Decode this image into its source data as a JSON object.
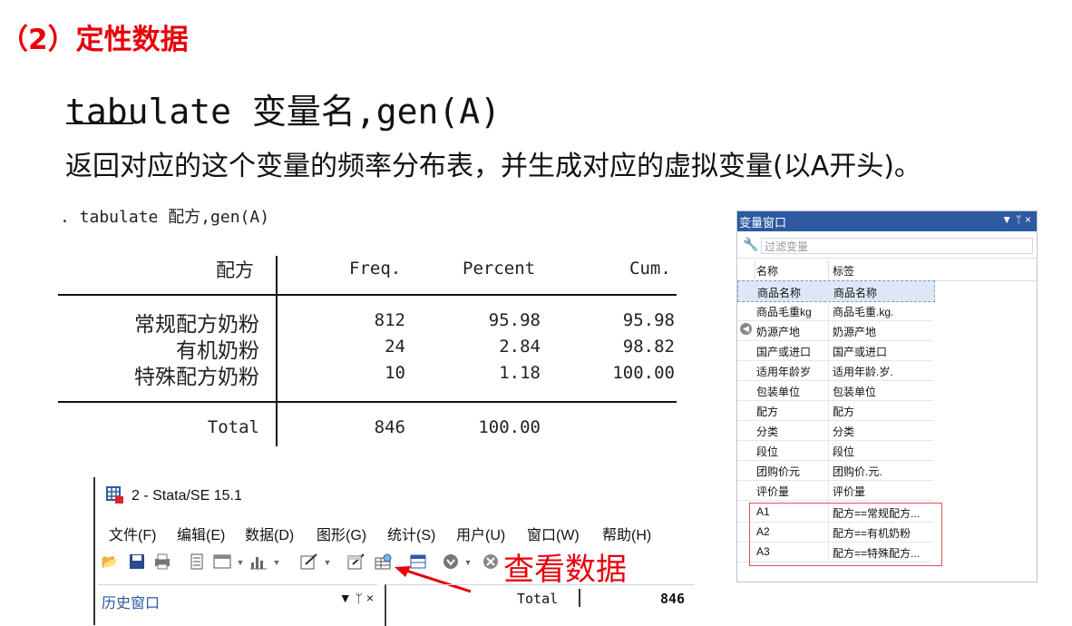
{
  "section_heading": "（2）定性数据",
  "command_syntax": "tabulate 变量名,gen(A)",
  "description": "返回对应的这个变量的频率分布表，并生成对应的虚拟变量(以A开头)。",
  "stata_output": {
    "command": ". tabulate 配方,gen(A)",
    "headers": {
      "var": "配方",
      "freq": "Freq.",
      "percent": "Percent",
      "cum": "Cum."
    },
    "rows": [
      {
        "label": "常规配方奶粉",
        "freq": "812",
        "percent": "95.98",
        "cum": "95.98"
      },
      {
        "label": "有机奶粉",
        "freq": "24",
        "percent": "2.84",
        "cum": "98.82"
      },
      {
        "label": "特殊配方奶粉",
        "freq": "10",
        "percent": "1.18",
        "cum": "100.00"
      }
    ],
    "total": {
      "label": "Total",
      "freq": "846",
      "percent": "100.00"
    }
  },
  "variables_window": {
    "title": "变量窗口",
    "controls": "▼ ᛘ ×",
    "filter_placeholder": "过滤变量",
    "col_name": "名称",
    "col_label": "标签",
    "variables": [
      {
        "name": "商品名称",
        "label": "商品名称"
      },
      {
        "name": "商品毛重kg",
        "label": "商品毛重.kg."
      },
      {
        "name": "奶源产地",
        "label": "奶源产地"
      },
      {
        "name": "国产或进口",
        "label": "国产或进口"
      },
      {
        "name": "适用年龄岁",
        "label": "适用年龄.岁."
      },
      {
        "name": "包装单位",
        "label": "包装单位"
      },
      {
        "name": "配方",
        "label": "配方"
      },
      {
        "name": "分类",
        "label": "分类"
      },
      {
        "name": "段位",
        "label": "段位"
      },
      {
        "name": "团购价元",
        "label": "团购价.元."
      },
      {
        "name": "评价量",
        "label": "评价量"
      },
      {
        "name": "A1",
        "label": "配方==常规配方..."
      },
      {
        "name": "A2",
        "label": "配方==有机奶粉"
      },
      {
        "name": "A3",
        "label": "配方==特殊配方..."
      }
    ]
  },
  "stata_window": {
    "title": "2 - Stata/SE 15.1",
    "menu": [
      "文件(F)",
      "编辑(E)",
      "数据(D)",
      "图形(G)",
      "统计(S)",
      "用户(U)",
      "窗口(W)",
      "帮助(H)"
    ],
    "history_title": "历史窗口",
    "history_controls": "▼ ᛘ ×",
    "results_total_label": "Total",
    "results_total_value": "846"
  },
  "annotation": "查看数据",
  "colors": {
    "accent_red": "#e8000b",
    "stata_blue": "#2d5aa0"
  }
}
